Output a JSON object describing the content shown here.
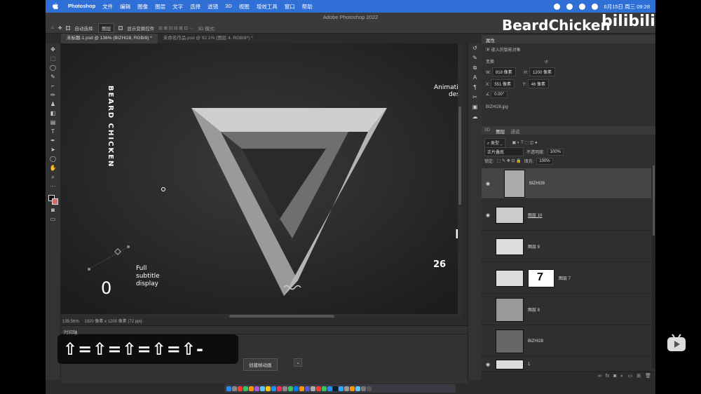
{
  "menubar": {
    "items": [
      "Photoshop",
      "文件",
      "编辑",
      "图像",
      "图层",
      "文字",
      "选择",
      "滤镜",
      "3D",
      "视图",
      "增效工具",
      "窗口",
      "帮助"
    ],
    "clock": "6月15日 周三  09:28"
  },
  "window": {
    "title": "Adobe Photoshop 2022"
  },
  "options": {
    "auto_select_label": "自动选择:",
    "layer_select": "图层",
    "show_transform_label": "显示变换控件",
    "mode_3d": "3D 模式:"
  },
  "tabs": [
    {
      "label": "未标题-1.psd @ 136% (BIZHI28, RGB/8) *"
    },
    {
      "label": "未命名作品.psd @ 92.1% (图层 4, RGB/8*) *"
    }
  ],
  "canvas": {
    "vertical_text": "BEARD CHICKEN",
    "right_text_1": "Animation",
    "right_text_2": "desi",
    "letter_r": "R",
    "number_26": "26",
    "zero": "0",
    "subtitle_line1": "Full",
    "subtitle_line2": "subtitle",
    "subtitle_line3": "display"
  },
  "status": {
    "zoom": "135.56%",
    "doc_size": "1920 像素 x 1200 像素 (72 ppi)"
  },
  "timeline": {
    "title": "时间轴",
    "create_button": "创建帧动画"
  },
  "properties": {
    "title": "属性",
    "object_type": "嵌入的智能对象",
    "transform_label": "变换",
    "w_label": "W:",
    "w_value": "818 像素",
    "h_label": "H:",
    "h_value": "1200 像素",
    "x_label": "X:",
    "x_value": "551 像素",
    "y_label": "Y:",
    "y_value": "46 像素",
    "angle_value": "0.00°",
    "file_name": "BIZHI28.jpg"
  },
  "layers_panel": {
    "tabs": [
      "3D",
      "图层",
      "通道"
    ],
    "filter_label": "类型",
    "blend_mode": "正片叠底",
    "opacity_label": "不透明度:",
    "opacity_value": "100%",
    "lock_label": "锁定:",
    "fill_label": "填充:",
    "fill_value": "100%",
    "layers": [
      {
        "name": "BIZHI28",
        "visible": true,
        "selected": true
      },
      {
        "name": "图层 10",
        "visible": true,
        "selected": false
      },
      {
        "name": "图层 9",
        "visible": false,
        "selected": false
      },
      {
        "name": "图层 7",
        "visible": false,
        "selected": false
      },
      {
        "name": "图层 8",
        "visible": false,
        "selected": false
      },
      {
        "name": "BIZHI28",
        "visible": false,
        "selected": false
      },
      {
        "name": "1",
        "visible": true,
        "selected": false
      }
    ]
  },
  "overlay": {
    "keys": "⇧=⇧=⇧=⇧=⇧-"
  },
  "watermark": {
    "channel": "BeardChicken",
    "platform": "bilibili"
  },
  "colors": {
    "accent": "#2f6fd6",
    "background_swatch": "#d66666"
  }
}
